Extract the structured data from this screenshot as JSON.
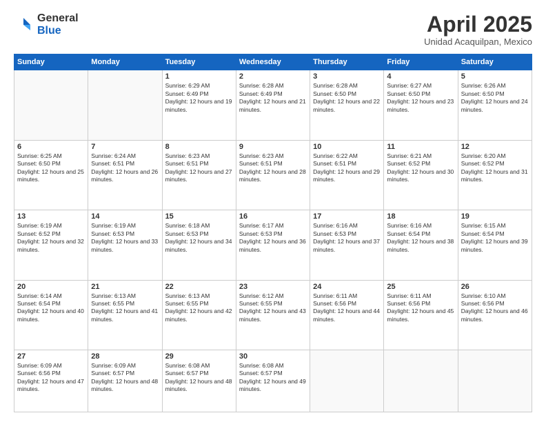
{
  "logo": {
    "general": "General",
    "blue": "Blue"
  },
  "title": "April 2025",
  "subtitle": "Unidad Acaquilpan, Mexico",
  "weekdays": [
    "Sunday",
    "Monday",
    "Tuesday",
    "Wednesday",
    "Thursday",
    "Friday",
    "Saturday"
  ],
  "weeks": [
    [
      {
        "day": "",
        "info": ""
      },
      {
        "day": "",
        "info": ""
      },
      {
        "day": "1",
        "info": "Sunrise: 6:29 AM\nSunset: 6:49 PM\nDaylight: 12 hours and 19 minutes."
      },
      {
        "day": "2",
        "info": "Sunrise: 6:28 AM\nSunset: 6:49 PM\nDaylight: 12 hours and 21 minutes."
      },
      {
        "day": "3",
        "info": "Sunrise: 6:28 AM\nSunset: 6:50 PM\nDaylight: 12 hours and 22 minutes."
      },
      {
        "day": "4",
        "info": "Sunrise: 6:27 AM\nSunset: 6:50 PM\nDaylight: 12 hours and 23 minutes."
      },
      {
        "day": "5",
        "info": "Sunrise: 6:26 AM\nSunset: 6:50 PM\nDaylight: 12 hours and 24 minutes."
      }
    ],
    [
      {
        "day": "6",
        "info": "Sunrise: 6:25 AM\nSunset: 6:50 PM\nDaylight: 12 hours and 25 minutes."
      },
      {
        "day": "7",
        "info": "Sunrise: 6:24 AM\nSunset: 6:51 PM\nDaylight: 12 hours and 26 minutes."
      },
      {
        "day": "8",
        "info": "Sunrise: 6:23 AM\nSunset: 6:51 PM\nDaylight: 12 hours and 27 minutes."
      },
      {
        "day": "9",
        "info": "Sunrise: 6:23 AM\nSunset: 6:51 PM\nDaylight: 12 hours and 28 minutes."
      },
      {
        "day": "10",
        "info": "Sunrise: 6:22 AM\nSunset: 6:51 PM\nDaylight: 12 hours and 29 minutes."
      },
      {
        "day": "11",
        "info": "Sunrise: 6:21 AM\nSunset: 6:52 PM\nDaylight: 12 hours and 30 minutes."
      },
      {
        "day": "12",
        "info": "Sunrise: 6:20 AM\nSunset: 6:52 PM\nDaylight: 12 hours and 31 minutes."
      }
    ],
    [
      {
        "day": "13",
        "info": "Sunrise: 6:19 AM\nSunset: 6:52 PM\nDaylight: 12 hours and 32 minutes."
      },
      {
        "day": "14",
        "info": "Sunrise: 6:19 AM\nSunset: 6:53 PM\nDaylight: 12 hours and 33 minutes."
      },
      {
        "day": "15",
        "info": "Sunrise: 6:18 AM\nSunset: 6:53 PM\nDaylight: 12 hours and 34 minutes."
      },
      {
        "day": "16",
        "info": "Sunrise: 6:17 AM\nSunset: 6:53 PM\nDaylight: 12 hours and 36 minutes."
      },
      {
        "day": "17",
        "info": "Sunrise: 6:16 AM\nSunset: 6:53 PM\nDaylight: 12 hours and 37 minutes."
      },
      {
        "day": "18",
        "info": "Sunrise: 6:16 AM\nSunset: 6:54 PM\nDaylight: 12 hours and 38 minutes."
      },
      {
        "day": "19",
        "info": "Sunrise: 6:15 AM\nSunset: 6:54 PM\nDaylight: 12 hours and 39 minutes."
      }
    ],
    [
      {
        "day": "20",
        "info": "Sunrise: 6:14 AM\nSunset: 6:54 PM\nDaylight: 12 hours and 40 minutes."
      },
      {
        "day": "21",
        "info": "Sunrise: 6:13 AM\nSunset: 6:55 PM\nDaylight: 12 hours and 41 minutes."
      },
      {
        "day": "22",
        "info": "Sunrise: 6:13 AM\nSunset: 6:55 PM\nDaylight: 12 hours and 42 minutes."
      },
      {
        "day": "23",
        "info": "Sunrise: 6:12 AM\nSunset: 6:55 PM\nDaylight: 12 hours and 43 minutes."
      },
      {
        "day": "24",
        "info": "Sunrise: 6:11 AM\nSunset: 6:56 PM\nDaylight: 12 hours and 44 minutes."
      },
      {
        "day": "25",
        "info": "Sunrise: 6:11 AM\nSunset: 6:56 PM\nDaylight: 12 hours and 45 minutes."
      },
      {
        "day": "26",
        "info": "Sunrise: 6:10 AM\nSunset: 6:56 PM\nDaylight: 12 hours and 46 minutes."
      }
    ],
    [
      {
        "day": "27",
        "info": "Sunrise: 6:09 AM\nSunset: 6:56 PM\nDaylight: 12 hours and 47 minutes."
      },
      {
        "day": "28",
        "info": "Sunrise: 6:09 AM\nSunset: 6:57 PM\nDaylight: 12 hours and 48 minutes."
      },
      {
        "day": "29",
        "info": "Sunrise: 6:08 AM\nSunset: 6:57 PM\nDaylight: 12 hours and 48 minutes."
      },
      {
        "day": "30",
        "info": "Sunrise: 6:08 AM\nSunset: 6:57 PM\nDaylight: 12 hours and 49 minutes."
      },
      {
        "day": "",
        "info": ""
      },
      {
        "day": "",
        "info": ""
      },
      {
        "day": "",
        "info": ""
      }
    ]
  ]
}
